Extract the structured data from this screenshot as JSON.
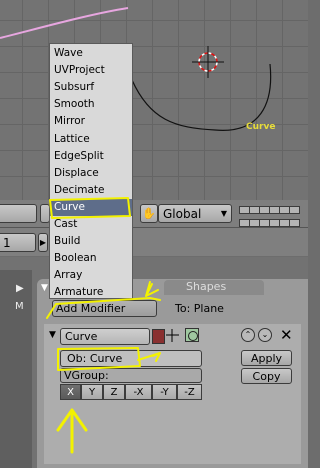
{
  "viewport": {
    "curve_label": "Curve"
  },
  "header": {
    "orientation": "Global"
  },
  "frame": {
    "value": "1"
  },
  "menu": {
    "items": [
      "Wave",
      "UVProject",
      "Subsurf",
      "Smooth",
      "Mirror",
      "Lattice",
      "EdgeSplit",
      "Displace",
      "Decimate",
      "Curve",
      "Cast",
      "Build",
      "Boolean",
      "Array",
      "Armature"
    ],
    "selected": "Curve"
  },
  "sidebar": {
    "m_label": "M"
  },
  "tabs": {
    "shapes": "Shapes"
  },
  "modifiers": {
    "add_label": "Add Modifier",
    "to_label": "To: Plane",
    "name": "Curve",
    "object_field": "Ob: Curve",
    "vgroup_label": "VGroup:",
    "apply_label": "Apply",
    "copy_label": "Copy",
    "axes": [
      "X",
      "Y",
      "Z",
      "-X",
      "-Y",
      "-Z"
    ]
  },
  "colors": {
    "annotation": "#f3f200",
    "menu_highlight": "#5e6d8a",
    "curve_label": "#e8dd3a"
  }
}
